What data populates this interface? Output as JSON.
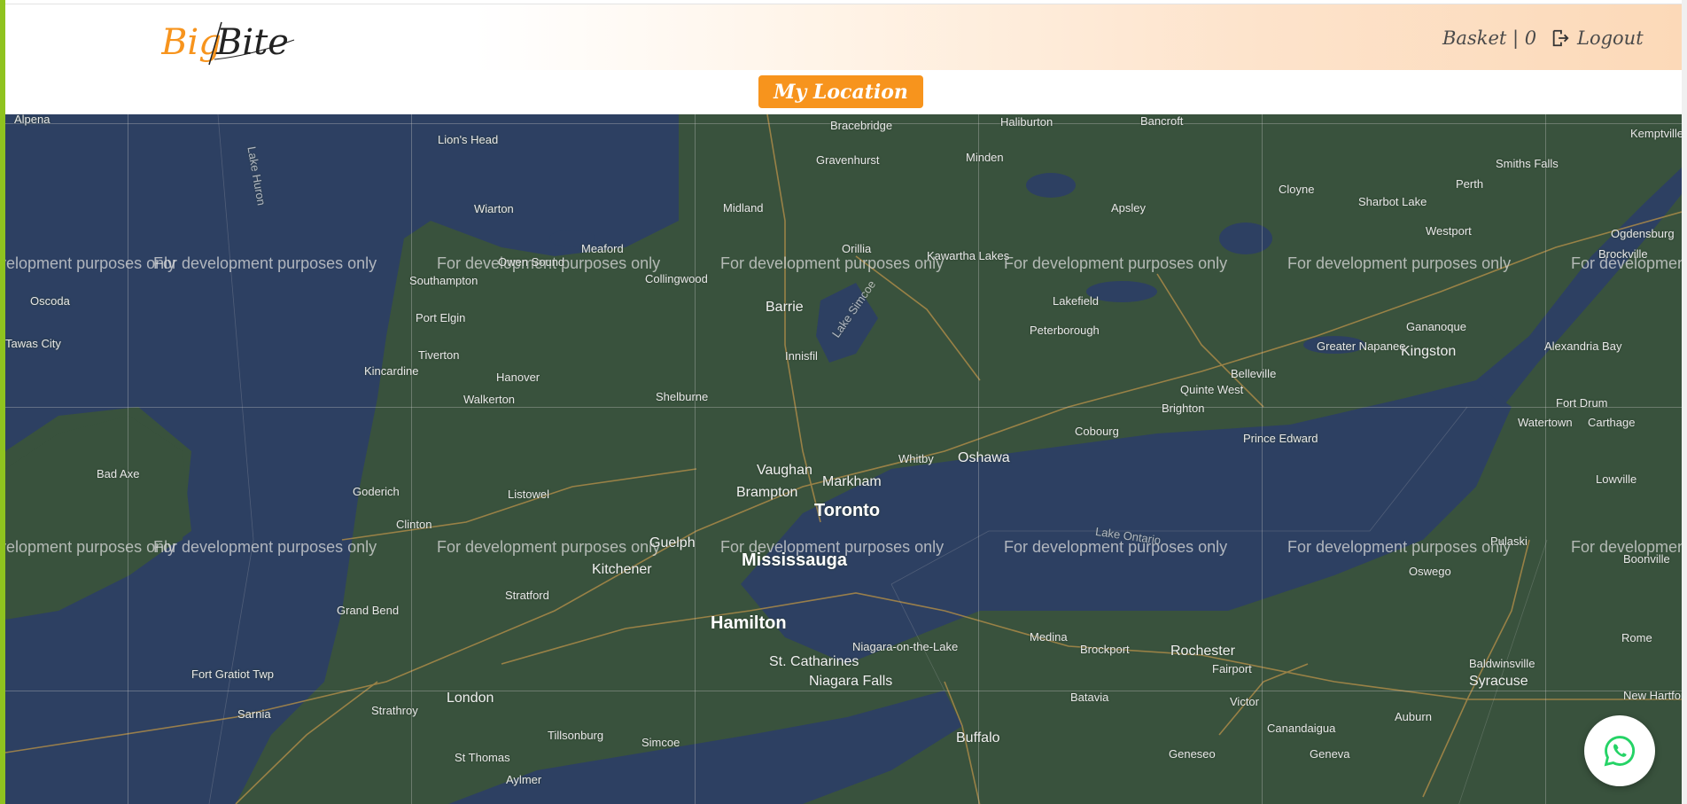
{
  "brand": {
    "logo_text_1": "Big",
    "logo_text_2": "Bite",
    "accent": "#f7941d",
    "strip_color": "#8fc31f"
  },
  "nav": {
    "basket_label": "Basket | 0",
    "logout_label": "Logout"
  },
  "location_button": {
    "label": "My Location"
  },
  "map": {
    "watermark": "For development purposes only",
    "labels_big": [
      "Toronto",
      "Mississauga",
      "Hamilton",
      "Oshawa",
      "Buffalo",
      "Rochester",
      "Syracuse",
      "Kingston",
      "Barrie",
      "London",
      "Markham",
      "Vaughan",
      "Brampton",
      "Guelph",
      "Kitchener"
    ],
    "labels_med": [
      "St. Catharines",
      "Niagara Falls",
      "Peterborough",
      "Belleville",
      "Orillia",
      "Midland",
      "Owen Sound",
      "Collingwood",
      "Stratford",
      "Sarnia",
      "Cobourg",
      "Whitby",
      "Brighton",
      "Quinte West",
      "Prince Edward",
      "Greater Napanee",
      "Oswego",
      "Fairport",
      "Batavia",
      "Brockport",
      "Medina",
      "Victor",
      "Geneseo",
      "Auburn",
      "Geneva",
      "Canandaigua",
      "Baldwinsville",
      "Niagara-on-the-Lake",
      "Simcoe",
      "Tillsonburg",
      "Strathroy",
      "Goderich",
      "Kincardine",
      "Port Elgin",
      "Southampton",
      "Wiarton",
      "Lion's Head",
      "Meaford",
      "Shelburne",
      "Hanover",
      "Walkerton",
      "Listowel",
      "Clinton",
      "Grand Bend",
      "Fort Gratiot Twp",
      "St Thomas",
      "Aylmer",
      "Innisfil",
      "Kawartha Lakes",
      "Lakefield",
      "Apsley",
      "Bancroft",
      "Haliburton",
      "Minden",
      "Bracebridge",
      "Gravenhurst",
      "Cloyne",
      "Sharbot Lake",
      "Westport",
      "Perth",
      "Smiths Falls",
      "Kemptville",
      "Ogdensburg",
      "Brockville",
      "Gananoque",
      "Alexandria Bay",
      "Fort Drum",
      "Watertown",
      "Carthage",
      "Lowville",
      "Pulaski",
      "Boonville",
      "Rome",
      "New Hartford",
      "Bad Axe",
      "Alpena",
      "Oscoda",
      "Tawas City",
      "Tiverton"
    ],
    "water_labels": [
      "Lake Huron",
      "Lake Ontario",
      "Lake Simcoe"
    ]
  }
}
